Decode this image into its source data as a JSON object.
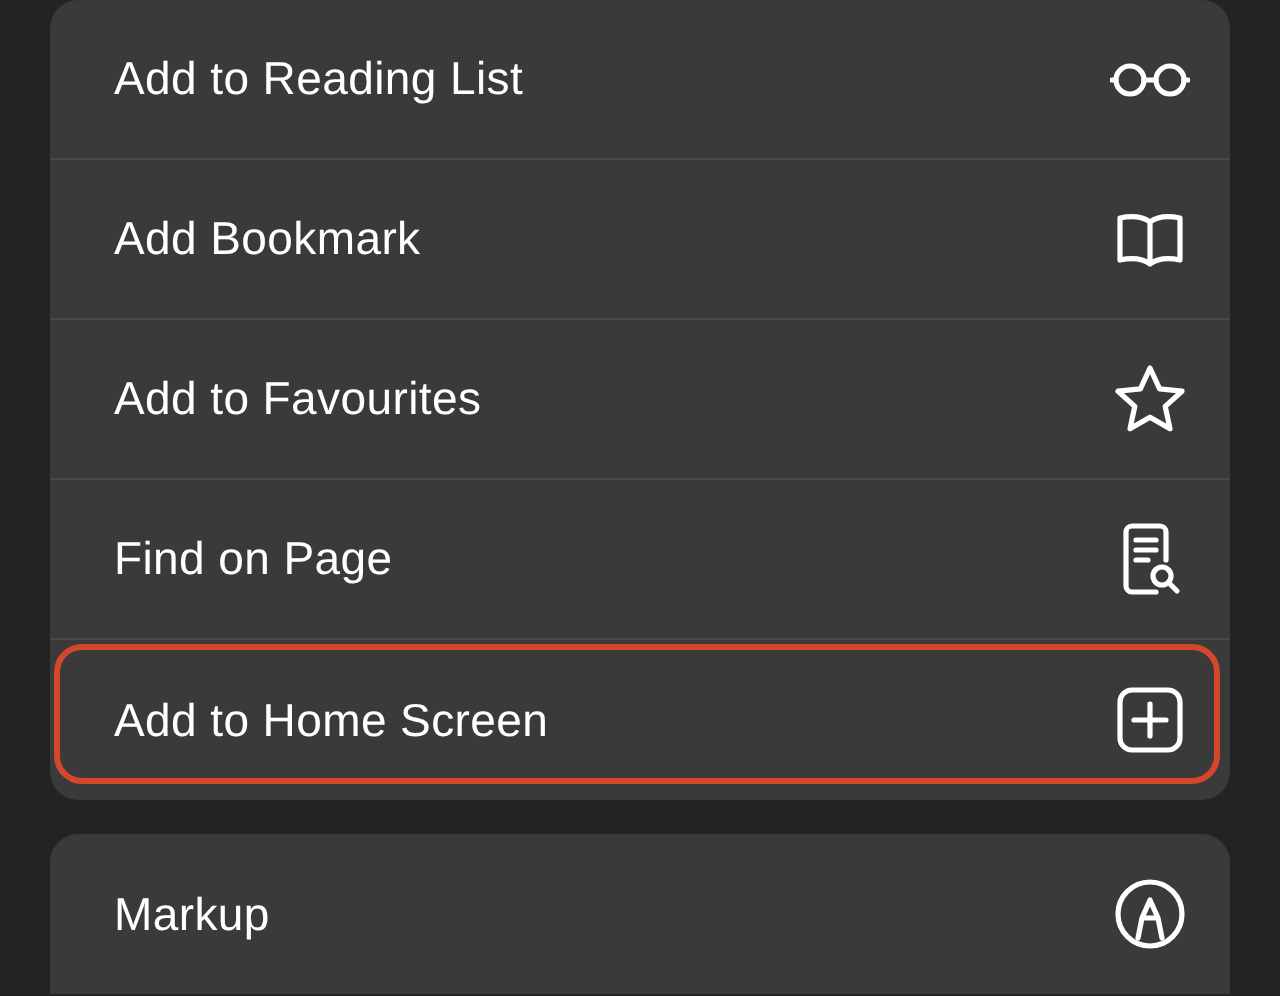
{
  "groups": [
    {
      "items": [
        {
          "label": "Add to Reading List",
          "highlighted": false
        },
        {
          "label": "Add Bookmark",
          "highlighted": false
        },
        {
          "label": "Add to Favourites",
          "highlighted": false
        },
        {
          "label": "Find on Page",
          "highlighted": false
        },
        {
          "label": "Add to Home Screen",
          "highlighted": true
        }
      ]
    },
    {
      "items": [
        {
          "label": "Markup",
          "highlighted": false
        }
      ]
    }
  ]
}
